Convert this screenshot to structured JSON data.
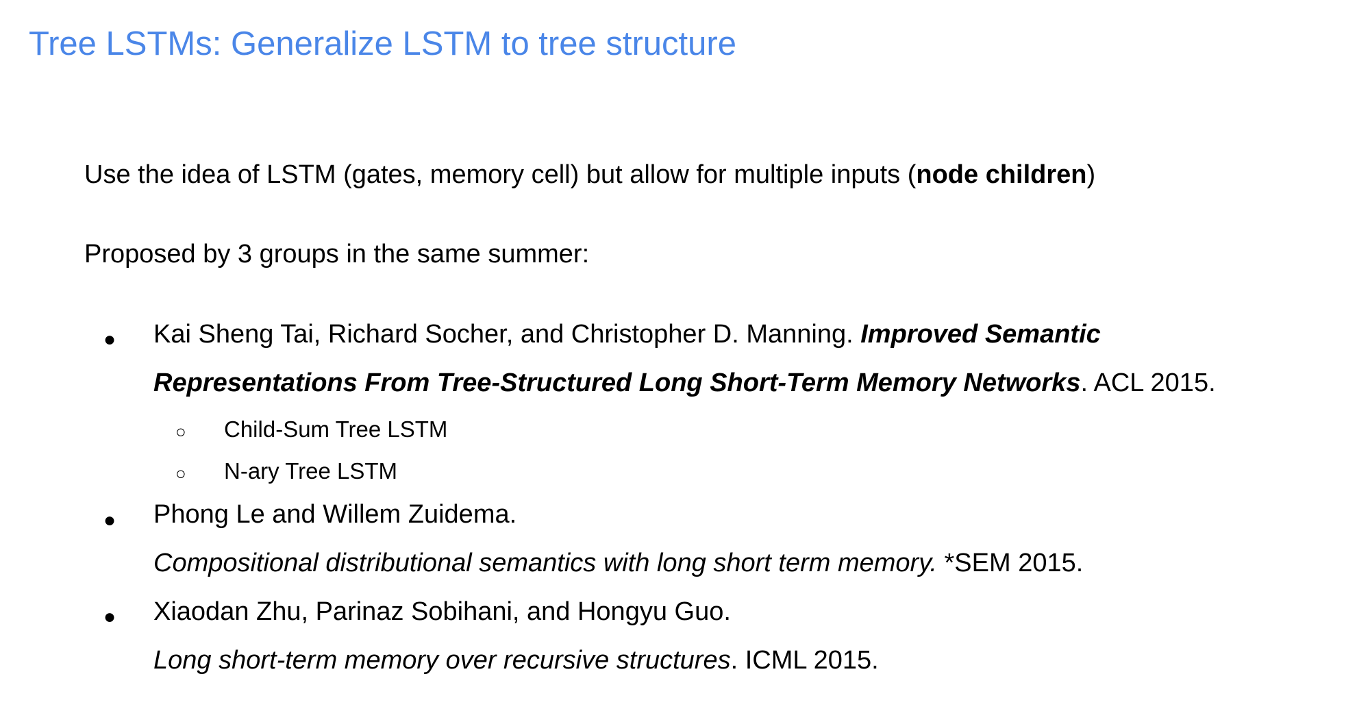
{
  "title": "Tree LSTMs: Generalize LSTM to tree structure",
  "intro": {
    "prefix": "Use the idea of LSTM (gates, memory cell) but allow for multiple inputs (",
    "bold": "node children",
    "suffix": ")"
  },
  "proposed": "Proposed by 3 groups in the same summer:",
  "bullet_symbol": "●",
  "sub_bullet_symbol": "○",
  "references": [
    {
      "authors": "Kai Sheng Tai, Richard Socher, and Christopher D. Manning. ",
      "title_line1": "Improved Semantic",
      "title_line2": "Representations From Tree-Structured Long Short-Term Memory Networks",
      "venue": ". ACL 2015.",
      "sub_items": [
        "Child-Sum Tree LSTM",
        "N-ary Tree LSTM"
      ]
    },
    {
      "authors": "Phong Le and Willem Zuidema.",
      "title": "Compositional distributional semantics with long short term memory.",
      "venue": " *SEM 2015."
    },
    {
      "authors": "Xiaodan Zhu, Parinaz Sobihani, and Hongyu Guo.",
      "title": "Long short-term memory over recursive structures",
      "venue": ". ICML 2015."
    }
  ]
}
